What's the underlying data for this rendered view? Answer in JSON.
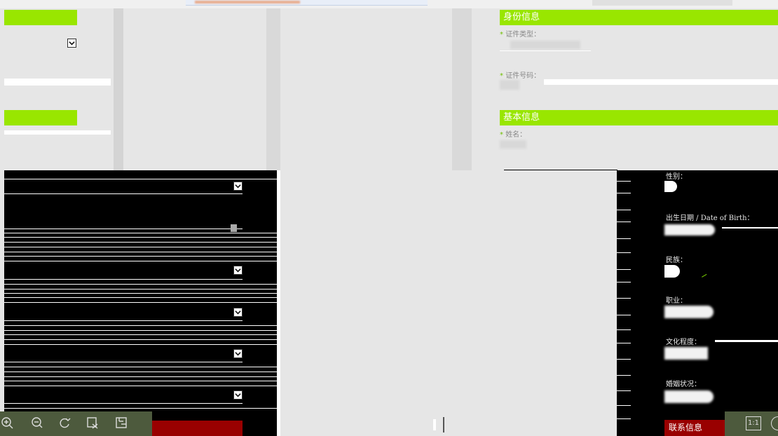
{
  "identity_section": {
    "title": "身份信息",
    "doc_type_label": "证件类型：",
    "doc_number_label": "证件号码："
  },
  "basic_section": {
    "title": "基本信息",
    "name_label": "姓名："
  },
  "right_form": {
    "gender_label": "性别：",
    "dob_label": "出生日期 / Date of Birth：",
    "ethnicity_label": "民族：",
    "occupation_label": "职业：",
    "education_label": "文化程度：",
    "marital_label": "婚姻状况："
  },
  "footer": {
    "contact_button": "联系信息",
    "fit_button": "1:1"
  },
  "toolbar": {
    "icons": [
      "zoom-in-icon",
      "zoom-out-icon",
      "rotate-icon",
      "crop-icon",
      "save-icon"
    ]
  },
  "colors": {
    "accent": "#99e600",
    "dark_red": "#990000",
    "black_panel": "#000000",
    "background": "#e6e6e6"
  }
}
